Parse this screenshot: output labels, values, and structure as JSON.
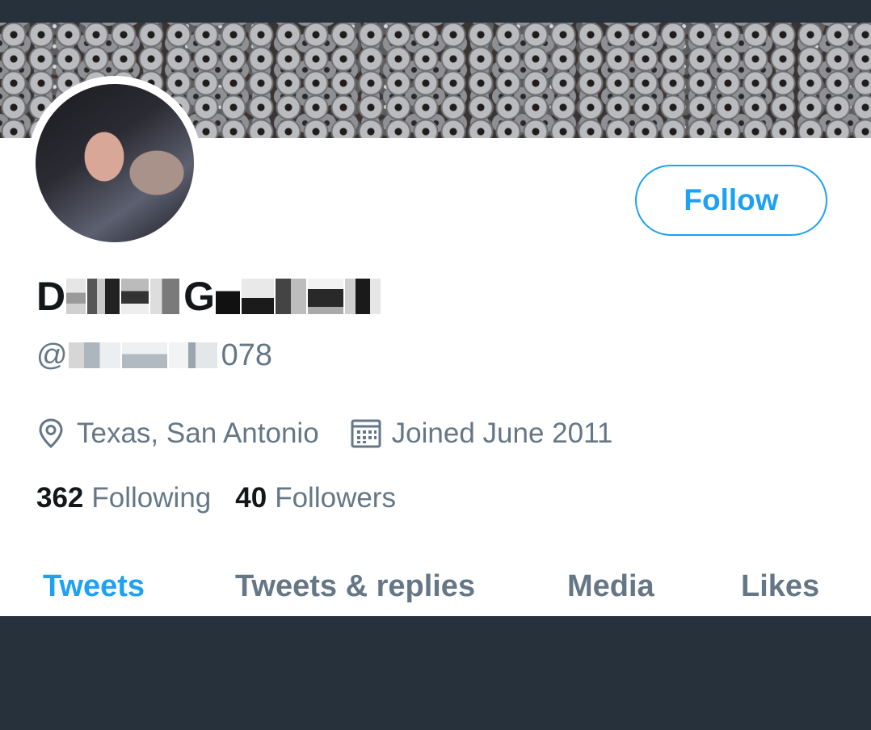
{
  "profile": {
    "display_name_prefix": "D",
    "display_name_mid": "G",
    "handle_prefix": "@",
    "handle_suffix": "078",
    "location": "Texas, San Antonio",
    "joined": "Joined June 2011",
    "following_count": "362",
    "following_label": "Following",
    "followers_count": "40",
    "followers_label": "Followers"
  },
  "actions": {
    "follow_label": "Follow"
  },
  "tabs": [
    {
      "label": "Tweets",
      "active": true
    },
    {
      "label": "Tweets & replies",
      "active": false
    },
    {
      "label": "Media",
      "active": false
    },
    {
      "label": "Likes",
      "active": false
    }
  ],
  "colors": {
    "accent": "#1da1f2",
    "secondary_text": "#657786",
    "primary_text": "#14171a",
    "frame": "#27313b"
  },
  "icons": {
    "location": "map-pin-icon",
    "joined": "calendar-icon"
  }
}
